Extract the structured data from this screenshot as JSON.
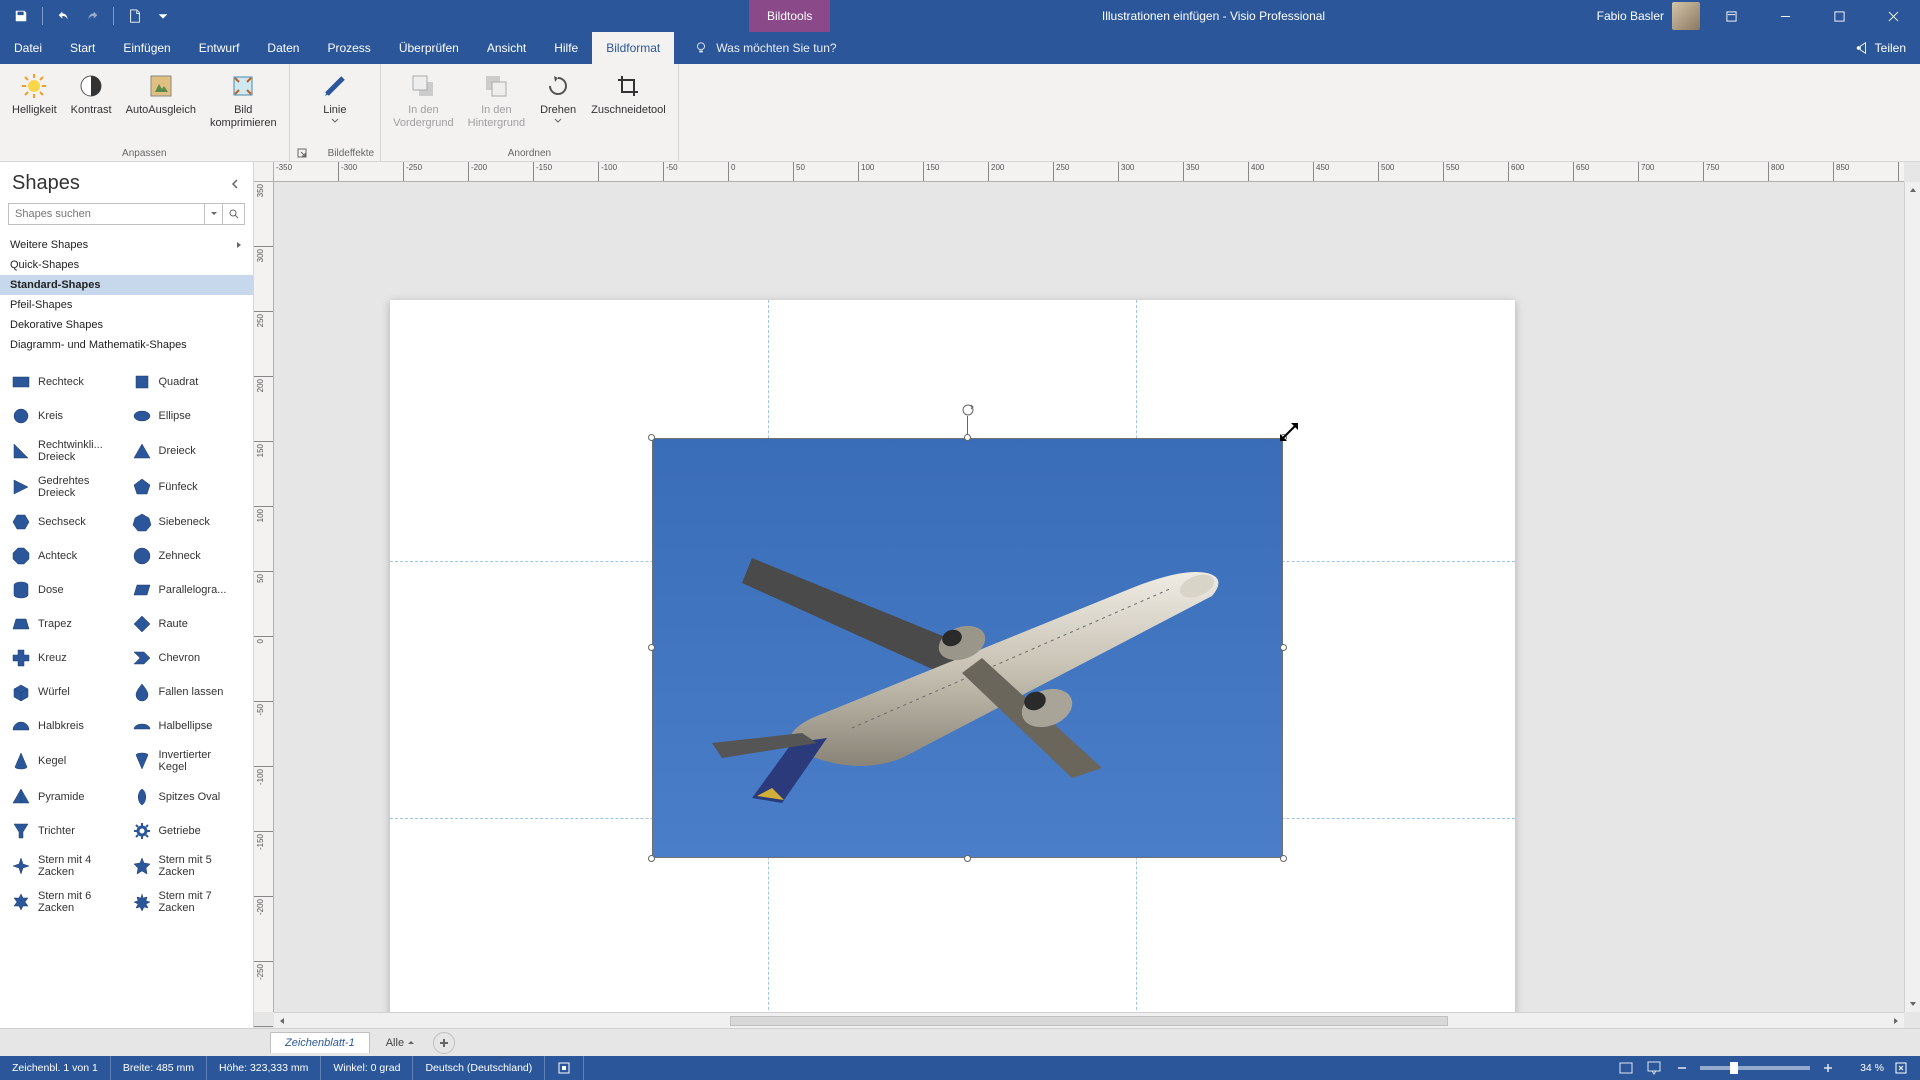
{
  "app": {
    "context_tab": "Bildtools",
    "title": "Illustrationen einfügen  -  Visio Professional",
    "user": "Fabio Basler"
  },
  "menu": {
    "datei": "Datei",
    "start": "Start",
    "einfugen": "Einfügen",
    "entwurf": "Entwurf",
    "daten": "Daten",
    "prozess": "Prozess",
    "uberprufen": "Überprüfen",
    "ansicht": "Ansicht",
    "hilfe": "Hilfe",
    "bildformat": "Bildformat",
    "tellme": "Was möchten Sie tun?",
    "teilen": "Teilen"
  },
  "ribbon": {
    "helligkeit": "Helligkeit",
    "kontrast": "Kontrast",
    "autoausgleich": "AutoAusgleich",
    "bild_komprimieren": "Bild\nkomprimieren",
    "anpassen": "Anpassen",
    "linie": "Linie",
    "bildeffekte": "Bildeffekte",
    "in_vordergrund": "In den\nVordergrund",
    "in_hintergrund": "In den\nHintergrund",
    "drehen": "Drehen",
    "zuschneidetool": "Zuschneidetool",
    "anordnen": "Anordnen"
  },
  "shapes": {
    "title": "Shapes",
    "search_placeholder": "Shapes suchen",
    "weitere": "Weitere Shapes",
    "quick": "Quick-Shapes",
    "standard": "Standard-Shapes",
    "pfeil": "Pfeil-Shapes",
    "dekorative": "Dekorative Shapes",
    "diagramm": "Diagramm- und Mathematik-Shapes",
    "items": {
      "rechteck": "Rechteck",
      "quadrat": "Quadrat",
      "kreis": "Kreis",
      "ellipse": "Ellipse",
      "rechtw_dreieck": "Rechtwinkli...\nDreieck",
      "dreieck": "Dreieck",
      "gedrehtes_dreieck": "Gedrehtes\nDreieck",
      "funfeck": "Fünfeck",
      "sechseck": "Sechseck",
      "siebeneck": "Siebeneck",
      "achteck": "Achteck",
      "zehneck": "Zehneck",
      "dose": "Dose",
      "parallelogramm": "Parallelogra...",
      "trapez": "Trapez",
      "raute": "Raute",
      "kreuz": "Kreuz",
      "chevron": "Chevron",
      "wurfel": "Würfel",
      "fallen_lassen": "Fallen lassen",
      "halbkreis": "Halbkreis",
      "halbellipse": "Halbellipse",
      "kegel": "Kegel",
      "inv_kegel": "Invertierter\nKegel",
      "pyramide": "Pyramide",
      "spitzes_oval": "Spitzes Oval",
      "trichter": "Trichter",
      "getriebe": "Getriebe",
      "stern4": "Stern mit 4\nZacken",
      "stern5": "Stern mit 5\nZacken",
      "stern6": "Stern mit 6\nZacken",
      "stern7": "Stern mit 7\nZacken"
    }
  },
  "ruler_h": [
    "-350",
    "-300",
    "-250",
    "-200",
    "-150",
    "-100",
    "-50",
    "0",
    "50",
    "100",
    "150",
    "200",
    "250",
    "300",
    "350",
    "400",
    "450",
    "500",
    "550",
    "600",
    "650",
    "700",
    "750",
    "800",
    "850"
  ],
  "ruler_v": [
    "350",
    "300",
    "250",
    "200",
    "150",
    "100",
    "50",
    "0",
    "-50",
    "-100",
    "-150",
    "-200",
    "-250"
  ],
  "sheets": {
    "s1": "Zeichenblatt-1",
    "all": "Alle"
  },
  "status": {
    "page": "Zeichenbl. 1 von 1",
    "breite": "Breite: 485 mm",
    "hohe": "Höhe: 323,333 mm",
    "winkel": "Winkel: 0 grad",
    "lang": "Deutsch (Deutschland)",
    "zoom": "34 %"
  }
}
